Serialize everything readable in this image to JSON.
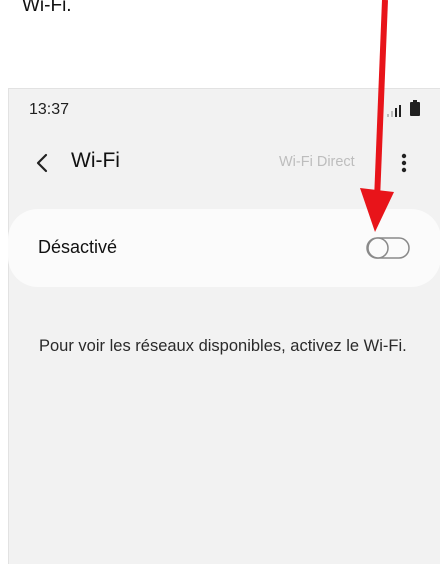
{
  "caption": {
    "text": "Wi-Fi."
  },
  "status_bar": {
    "time": "13:37"
  },
  "app_bar": {
    "title": "Wi-Fi",
    "wifi_direct_label": "Wi-Fi Direct"
  },
  "wifi_toggle": {
    "label": "Désactivé",
    "state": "off"
  },
  "info": {
    "text": "Pour voir les réseaux disponibles, activez le Wi-Fi."
  },
  "colors": {
    "annotation_arrow": "#e8141a",
    "screen_background": "#f2f2f2",
    "card_background": "#fbfbfb"
  }
}
